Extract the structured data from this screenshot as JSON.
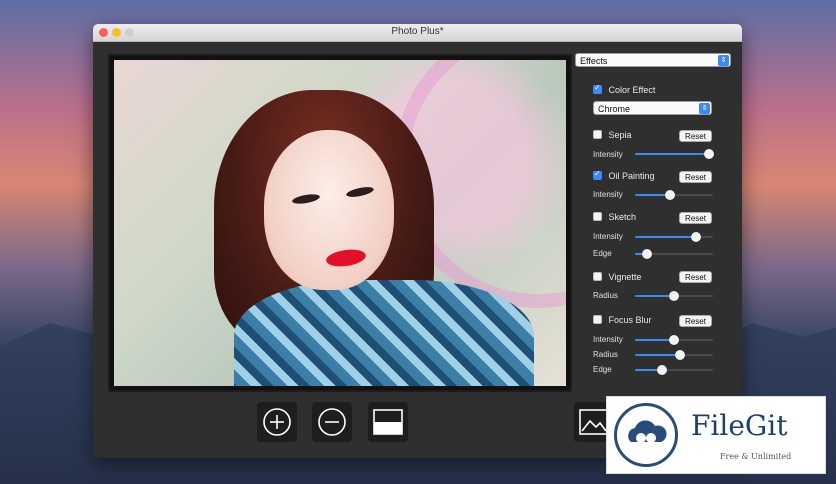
{
  "window": {
    "title": "Photo Plus*"
  },
  "panel": {
    "mode_dropdown": "Effects",
    "color_effect": {
      "label": "Color Effect",
      "checked": true,
      "preset": "Chrome"
    },
    "sepia": {
      "label": "Sepia",
      "checked": false,
      "reset": "Reset",
      "sliders": [
        {
          "label": "Intensity",
          "value": 0.95
        }
      ]
    },
    "oil_painting": {
      "label": "Oil Painting",
      "checked": true,
      "reset": "Reset",
      "sliders": [
        {
          "label": "Intensity",
          "value": 0.45
        }
      ]
    },
    "sketch": {
      "label": "Sketch",
      "checked": false,
      "reset": "Reset",
      "sliders": [
        {
          "label": "Intensity",
          "value": 0.78
        },
        {
          "label": "Edge",
          "value": 0.15
        }
      ]
    },
    "vignette": {
      "label": "Vignette",
      "checked": false,
      "reset": "Reset",
      "sliders": [
        {
          "label": "Radius",
          "value": 0.5
        }
      ]
    },
    "focus_blur": {
      "label": "Focus Blur",
      "checked": false,
      "reset": "Reset",
      "sliders": [
        {
          "label": "Intensity",
          "value": 0.5
        },
        {
          "label": "Radius",
          "value": 0.58
        },
        {
          "label": "Edge",
          "value": 0.35
        }
      ]
    }
  },
  "toolbar": {
    "icons": [
      "zoom-in-icon",
      "zoom-out-icon",
      "split-view-icon",
      "image-icon"
    ]
  },
  "watermark": {
    "brand": "FileGit",
    "tagline": "Free & Unlimited"
  },
  "colors": {
    "accent": "#3b8af5",
    "window_bg": "#2f2f2f",
    "lips": "#e2102a"
  }
}
